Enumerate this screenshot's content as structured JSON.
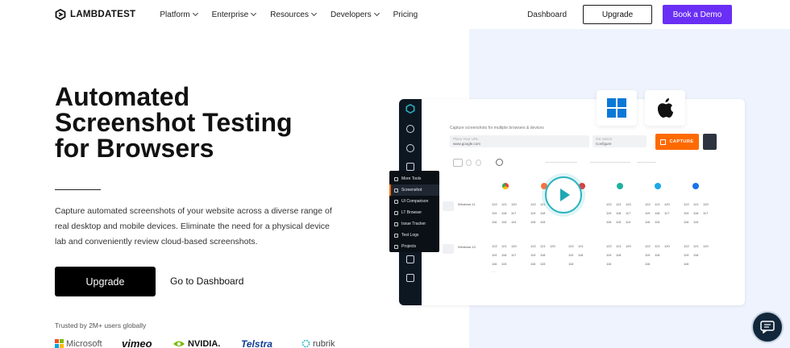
{
  "nav": {
    "brand": "LAMBDATEST",
    "menu": [
      "Platform",
      "Enterprise",
      "Resources",
      "Developers",
      "Pricing"
    ],
    "dashboard_label": "Dashboard",
    "upgrade_label": "Upgrade",
    "demo_label": "Book a Demo"
  },
  "hero": {
    "title_lines": [
      "Automated",
      "Screenshot Testing",
      "for Browsers"
    ],
    "description": "Capture automated screenshots of your website across a diverse range of real desktop and mobile devices. Eliminate the need for a physical device lab and conveniently review cloud-based screenshots.",
    "primary_cta": "Upgrade",
    "secondary_cta": "Go to Dashboard",
    "trusted_text": "Trusted by 2M+ users globally",
    "brands": [
      "Microsoft",
      "vimeo",
      "NVIDIA.",
      "Telstra",
      "rubrik"
    ]
  },
  "app": {
    "heading": "Capture screenshots for multiple browsers & devices",
    "url_value": "www.google.com",
    "os_value": "Configure",
    "capture_label": "CAPTURE",
    "menu": [
      "More Tools",
      "Screenshot",
      "UI Comparison",
      "LT Browser",
      "Issue Tracker",
      "Test Logs",
      "Projects"
    ],
    "os_rows": [
      "Windows 11",
      "Windows 10"
    ],
    "version_rows": [
      [
        "122",
        "121",
        "120"
      ],
      [
        "119",
        "118",
        "117"
      ],
      [
        "116",
        "115",
        "114"
      ]
    ]
  },
  "colors": {
    "accent": "#6a2ff5",
    "capture": "#ff6a00",
    "teal": "#2bb3c0",
    "panel_bg": "#eef3fd"
  }
}
